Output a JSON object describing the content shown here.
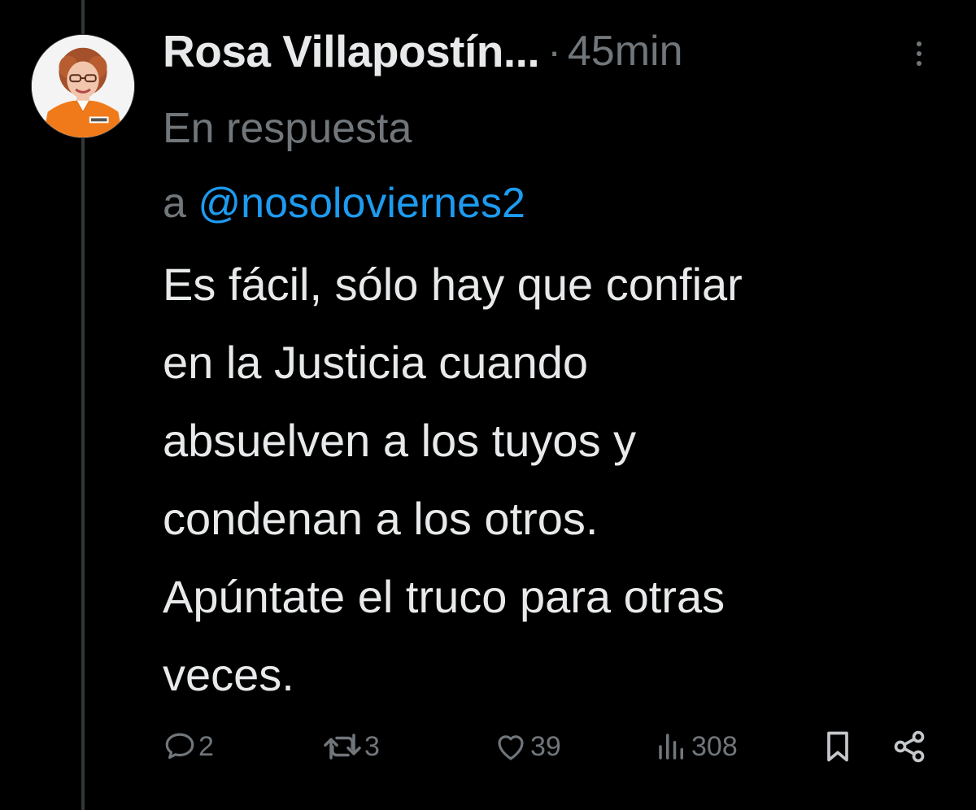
{
  "tweet": {
    "author_name": "Rosa Villapostín...",
    "separator": "·",
    "time": "45min",
    "reply_prefix": "En respuesta",
    "reply_a": "a",
    "reply_handle": "@nosoloviernes2",
    "text": "Es fácil, sólo hay que confiar\nen la Justicia cuando\nabsuelven a los tuyos y\ncondenan a los otros.\nApúntate el truco para otras\nveces."
  },
  "actions": {
    "replies": "2",
    "reposts": "3",
    "likes": "39",
    "views": "308"
  },
  "icons": {
    "more": "more-vertical-icon",
    "reply": "reply-bubble-icon",
    "repost": "repost-icon",
    "like": "heart-icon",
    "views": "views-bars-icon",
    "bookmark": "bookmark-icon",
    "share": "share-icon"
  },
  "colors": {
    "background": "#000000",
    "text_primary": "#e7e9ea",
    "text_secondary": "#71767b",
    "link": "#1d9bf0",
    "avatar_shirt": "#f07a1a"
  }
}
